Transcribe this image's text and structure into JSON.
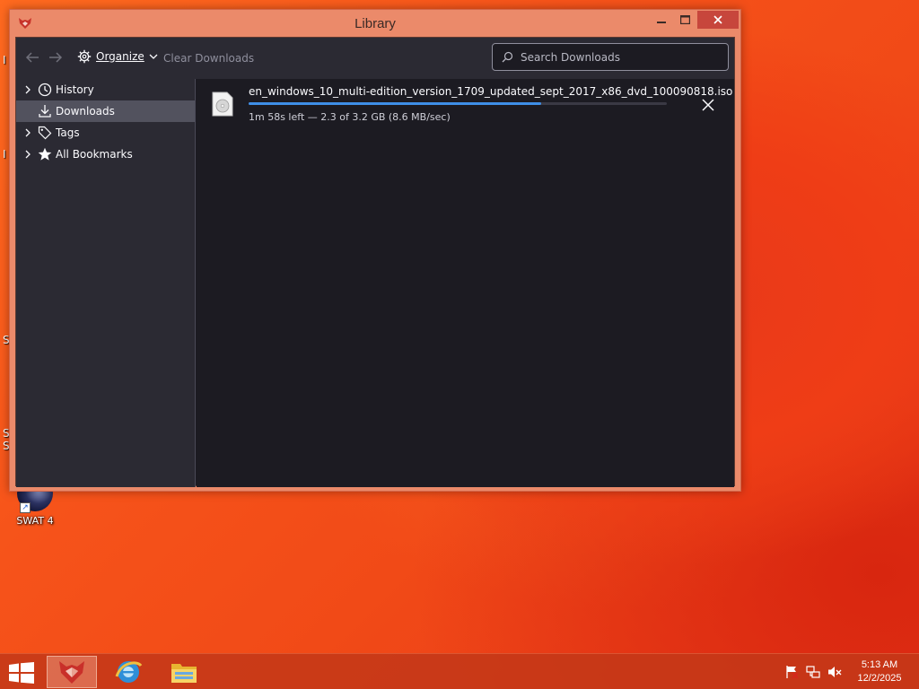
{
  "window": {
    "title": "Library",
    "colors": {
      "frame": "#eb8a6a",
      "close": "#c7463c",
      "panel": "#2b2a33",
      "content": "#1c1b22",
      "accent": "#3f8fe8"
    }
  },
  "toolbar": {
    "back_icon": "arrow-left-icon",
    "forward_icon": "arrow-right-icon",
    "organize_label": "Organize",
    "clear_downloads_label": "Clear Downloads",
    "search_placeholder": "Search Downloads",
    "search_value": ""
  },
  "sidebar": {
    "items": [
      {
        "label": "History",
        "icon": "clock-icon",
        "expandable": true,
        "selected": false
      },
      {
        "label": "Downloads",
        "icon": "download-icon",
        "expandable": false,
        "selected": true
      },
      {
        "label": "Tags",
        "icon": "tag-icon",
        "expandable": true,
        "selected": false
      },
      {
        "label": "All Bookmarks",
        "icon": "star-icon",
        "expandable": true,
        "selected": false
      }
    ]
  },
  "downloads": [
    {
      "filename": "en_windows_10_multi-edition_version_1709_updated_sept_2017_x86_dvd_100090818.iso",
      "status": "1m 58s left — 2.3 of 3.2 GB (8.6 MB/sec)",
      "progress_fraction": 0.7,
      "icon": "disc-image-file-icon"
    }
  ],
  "desktop": {
    "icons": [
      {
        "label": "SWAT 4",
        "icon": "swat4-game-icon"
      }
    ]
  },
  "taskbar": {
    "apps": [
      {
        "name": "waterfox-browser",
        "active": true
      },
      {
        "name": "internet-explorer",
        "active": false
      },
      {
        "name": "file-explorer",
        "active": false
      }
    ],
    "tray": [
      "action-center-flag-icon",
      "network-icon",
      "volume-muted-icon"
    ],
    "time": "5:13 AM",
    "date": "12/2/2025"
  }
}
